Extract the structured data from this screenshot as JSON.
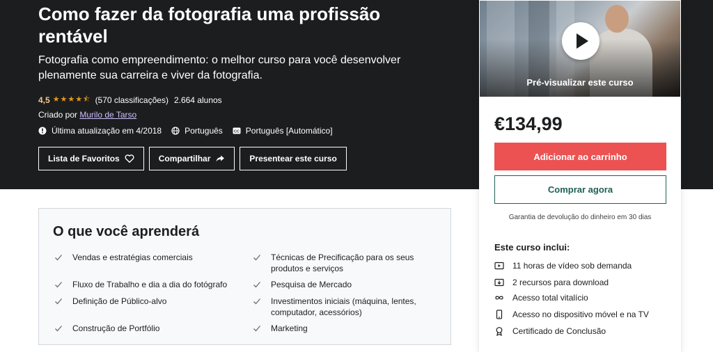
{
  "hero": {
    "title": "Como fazer da fotografia uma profissão rentável",
    "subtitle": "Fotografia como empreendimento: o melhor curso para você desenvolver plenamente sua carreira e viver da fotografia.",
    "rating_value": "4,5",
    "rating_stars": 4.5,
    "ratings_count": "(570 classificações)",
    "students": "2.664 alunos",
    "created_by_label": "Criado por",
    "creator": "Murilo de Tarso",
    "last_updated": "Última atualização em 4/2018",
    "language": "Português",
    "captions": "Português [Automático]",
    "buttons": {
      "wishlist": "Lista de Favoritos",
      "share": "Compartilhar",
      "gift": "Presentear este curso"
    }
  },
  "learn": {
    "title": "O que você aprenderá",
    "items_left": [
      "Vendas e estratégias comerciais",
      "Fluxo de Trabalho e dia a dia do fotógrafo",
      "Definição de Público-alvo",
      "Construção de Portfólio"
    ],
    "items_right": [
      "Técnicas de Precificação para os seus produtos e serviços",
      "Pesquisa de Mercado",
      "Investimentos iniciais (máquina, lentes, computador, acessórios)",
      "Marketing"
    ]
  },
  "sidebar": {
    "preview_label": "Pré-visualizar este curso",
    "price": "€134,99",
    "add_to_cart": "Adicionar ao carrinho",
    "buy_now": "Comprar agora",
    "guarantee": "Garantia de devolução do dinheiro em 30 dias",
    "includes_title": "Este curso inclui:",
    "includes": [
      {
        "icon": "video-icon",
        "text": "11 horas de vídeo sob demanda"
      },
      {
        "icon": "download-file-icon",
        "text": "2 recursos para download"
      },
      {
        "icon": "infinity-icon",
        "text": "Acesso total vitalício"
      },
      {
        "icon": "mobile-icon",
        "text": "Acesso no dispositivo móvel e na TV"
      },
      {
        "icon": "certificate-icon",
        "text": "Certificado de Conclusão"
      }
    ]
  },
  "colors": {
    "hero_bg": "#1c1d1f",
    "star": "#e59819",
    "rating": "#f3ca8c",
    "link": "#cec0fc",
    "cart": "#ec5252",
    "buy_outline": "#1e6055"
  }
}
